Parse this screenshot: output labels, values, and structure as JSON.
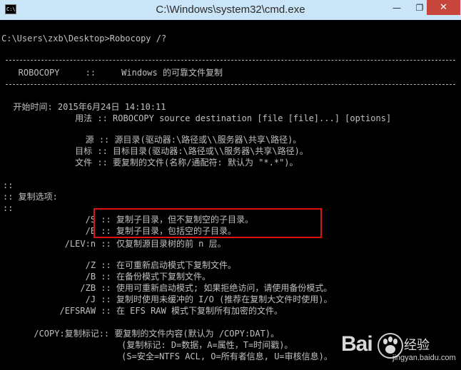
{
  "window": {
    "title": "C:\\Windows\\system32\\cmd.exe",
    "icon_text": "C:\\",
    "minimize": "—",
    "maximize": "❐",
    "close": "✕"
  },
  "console": {
    "prompt": "C:\\Users\\zxb\\Desktop>Robocopy /?",
    "header": "   ROBOCOPY     ::     Windows 的可靠文件复制",
    "start_time": "  开始时间: 2015年6月24日 14:10:11",
    "usage": "              用法 :: ROBOCOPY source destination [file [file]...] [options]",
    "src": "                源 :: 源目录(驱动器:\\路径或\\\\服务器\\共享\\路径)。",
    "dst": "              目标 :: 目标目录(驱动器:\\路径或\\\\服务器\\共享\\路径)。",
    "file": "              文件 :: 要复制的文件(名称/通配符: 默认为 \"*.*\")。",
    "sep1": "::",
    "copy_options": ":: 复制选项:",
    "sep2": "::",
    "opt_s": "                /S :: 复制子目录，但不复制空的子目录。",
    "opt_e": "                /E :: 复制子目录，包括空的子目录。",
    "opt_lev": "            /LEV:n :: 仅复制源目录树的前 n 层。",
    "opt_z": "                /Z :: 在可重新启动模式下复制文件。",
    "opt_b": "                /B :: 在备份模式下复制文件。",
    "opt_zb": "               /ZB :: 使用可重新启动模式; 如果拒绝访问，请使用备份模式。",
    "opt_j": "                /J :: 复制时使用未缓冲的 I/O (推荐在复制大文件时使用)。",
    "opt_efsraw": "           /EFSRAW :: 在 EFS RAW 模式下复制所有加密的文件。",
    "opt_copy": "      /COPY:复制标记:: 要复制的文件内容(默认为 /COPY:DAT)。",
    "copy_flags1": "                       (复制标记: D=数据，A=属性，T=时间戳)。",
    "copy_flags2": "                       (S=安全=NTFS ACL, O=所有者信息, U=审核信息)。"
  },
  "watermark": {
    "logo": "Bai",
    "sub": "经验",
    "url": "jingyan.baidu.com"
  }
}
